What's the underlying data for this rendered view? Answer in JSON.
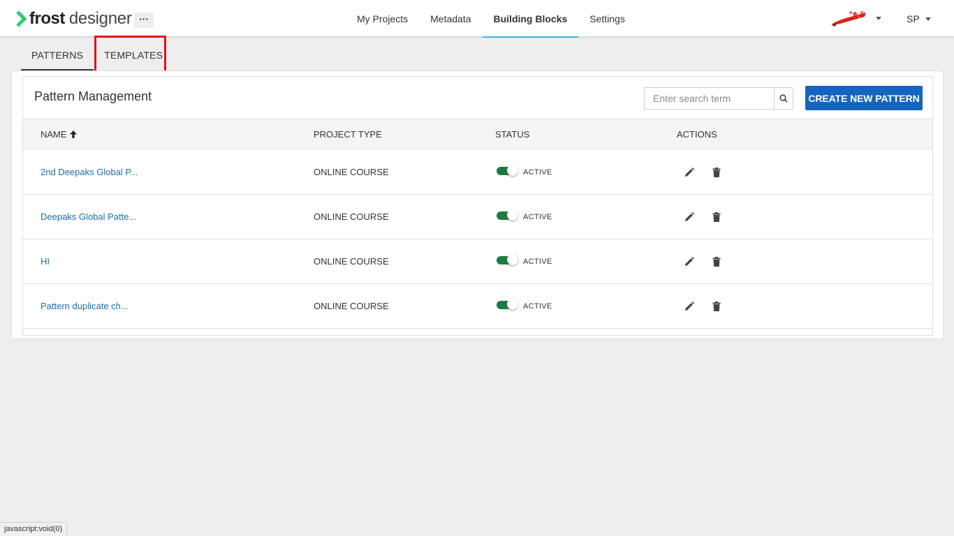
{
  "header": {
    "logo_strong": "frost",
    "logo_light": "designer",
    "more_label": "···",
    "nav": [
      {
        "label": "My Projects"
      },
      {
        "label": "Metadata"
      },
      {
        "label": "Building Blocks",
        "active": true
      },
      {
        "label": "Settings"
      }
    ],
    "user_initials": "SP"
  },
  "subtabs": [
    {
      "label": "PATTERNS",
      "active": true
    },
    {
      "label": "TEMPLATES"
    }
  ],
  "main": {
    "title": "Pattern Management",
    "search_placeholder": "Enter search term",
    "create_label": "CREATE NEW PATTERN",
    "columns": {
      "name": "NAME",
      "project_type": "PROJECT TYPE",
      "status": "STATUS",
      "actions": "ACTIONS"
    },
    "sort_icon": "arrow-up-icon",
    "rows": [
      {
        "name": "2nd Deepaks Global P...",
        "project_type": "ONLINE COURSE",
        "status": "ACTIVE"
      },
      {
        "name": "Deepaks Global Patte...",
        "project_type": "ONLINE COURSE",
        "status": "ACTIVE"
      },
      {
        "name": "HI",
        "project_type": "ONLINE COURSE",
        "status": "ACTIVE"
      },
      {
        "name": "Pattern duplicate ch...",
        "project_type": "ONLINE COURSE",
        "status": "ACTIVE"
      }
    ]
  },
  "statusbar": {
    "text": "javascript:void(0)"
  },
  "colors": {
    "brand_green": "#2ecc71",
    "primary_button": "#1565c0",
    "link": "#1a6fa8",
    "toggle_on": "#1f7a42",
    "nav_active_underline": "#37c0d8",
    "highlight": "#e0131a"
  }
}
